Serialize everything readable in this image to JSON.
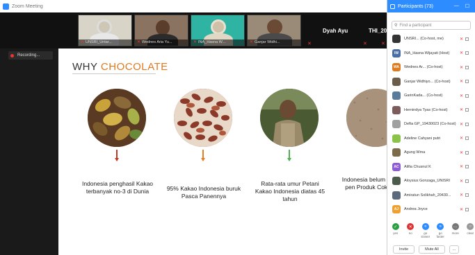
{
  "window": {
    "title": "Zoom Meeting"
  },
  "video_strip": {
    "tiles": [
      {
        "name": "UNSRI_Untar..."
      },
      {
        "name": "Wednes Aria Yu..."
      },
      {
        "name": "INA_Hasna W..."
      },
      {
        "name": "Ganjar Widhi..."
      }
    ],
    "named_tiles": [
      {
        "name": "Dyah Ayu"
      },
      {
        "name": "THI_20"
      }
    ]
  },
  "recording": {
    "label": "Recording..."
  },
  "slide": {
    "title_prefix": "WHY ",
    "title_accent": "CHOCOLATE",
    "captions": [
      "Indonesia penghasil Kakao terbanyak no-3 di Dunia",
      "95% Kakao Indonesia buruk Pasca Panennya",
      "Rata-rata umur Petani Kakao Indonesia diatas 45 tahun",
      "Indonesia belum sebagai pen Produk Cokel baik"
    ],
    "stem_colors": [
      "#c0392b",
      "#e67e22",
      "#4caf50"
    ]
  },
  "participants_panel": {
    "title": "Participants (73)",
    "search_placeholder": "Find a participant",
    "participants": [
      {
        "name": "UNSRI... (Co-host, me)",
        "initials": "",
        "color": "#333333"
      },
      {
        "name": "INA_Hasna Wijayati (Host)",
        "initials": "IW",
        "color": "#4a6fa5"
      },
      {
        "name": "Wednes Ar... (Co-host)",
        "initials": "WA",
        "color": "#e07a1f"
      },
      {
        "name": "Ganjar Widhiyo... (Co-host)",
        "initials": "",
        "color": "#6b5b4b"
      },
      {
        "name": "GarinKada... (Co-host)",
        "initials": "",
        "color": "#5b7b9b"
      },
      {
        "name": "Hernindya Tyas (Co-host)",
        "initials": "",
        "color": "#7b5b5b"
      },
      {
        "name": "Defta GP_19430023 (Co-host)",
        "initials": "",
        "color": "#a0a0a0"
      },
      {
        "name": "Adeline Cahyani putri",
        "initials": "",
        "color": "#8bc34a"
      },
      {
        "name": "Agung Wma",
        "initials": "",
        "color": "#7b6b4b"
      },
      {
        "name": "Alifia Chusnul K",
        "initials": "AC",
        "color": "#8e5bd6"
      },
      {
        "name": "Aloysius Gonzaga_UNISRI",
        "initials": "",
        "color": "#4b5b4b"
      },
      {
        "name": "Amiratun Solikhah_20430...",
        "initials": "",
        "color": "#5b6b7b"
      },
      {
        "name": "Andrea Joyce",
        "initials": "AJ",
        "color": "#f0a030"
      }
    ],
    "reactions": [
      {
        "label": "yes",
        "symbol": "✓",
        "color": "#2e9e44"
      },
      {
        "label": "no",
        "symbol": "✕",
        "color": "#d33"
      },
      {
        "label": "go slower",
        "symbol": "«",
        "color": "#2d8cff"
      },
      {
        "label": "go faster",
        "symbol": "»",
        "color": "#2d8cff"
      },
      {
        "label": "more",
        "symbol": "…",
        "color": "#777"
      },
      {
        "label": "clear",
        "symbol": "○",
        "color": "#999"
      }
    ],
    "buttons": {
      "invite": "Invite",
      "mute_all": "Mute All",
      "more": "..."
    }
  }
}
